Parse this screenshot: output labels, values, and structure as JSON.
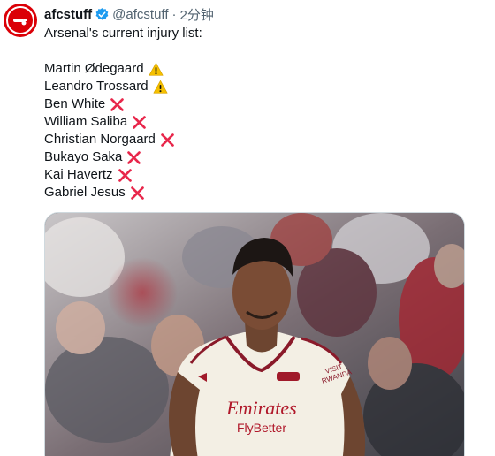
{
  "author": {
    "display_name": "afcstuff",
    "handle": "@afcstuff",
    "separator": "·",
    "time": "2分钟",
    "verified": true,
    "avatar_color": "#db0007"
  },
  "tweet": {
    "intro": "Arsenal's current injury list:",
    "players": [
      {
        "name": "Martin Ødegaard",
        "status_icon": "warning-icon"
      },
      {
        "name": "Leandro Trossard",
        "status_icon": "warning-icon"
      },
      {
        "name": "Ben White",
        "status_icon": "cross-mark-icon"
      },
      {
        "name": "William Saliba",
        "status_icon": "cross-mark-icon"
      },
      {
        "name": "Christian Norgaard",
        "status_icon": "cross-mark-icon"
      },
      {
        "name": "Bukayo Saka",
        "status_icon": "cross-mark-icon"
      },
      {
        "name": "Kai Havertz",
        "status_icon": "cross-mark-icon"
      },
      {
        "name": "Gabriel Jesus",
        "status_icon": "cross-mark-icon"
      }
    ]
  },
  "media": {
    "sponsor_line1": "Emirates",
    "sponsor_line2": "FlyBetter",
    "sleeve_text_1": "VISIT",
    "sleeve_text_2": "RWANDA",
    "kit_color": "#f3efe4",
    "trim_color": "#8a1a2a"
  },
  "colors": {
    "verified": "#1d9bf0",
    "warning": "#f5c000",
    "cross": "#e8274b"
  }
}
